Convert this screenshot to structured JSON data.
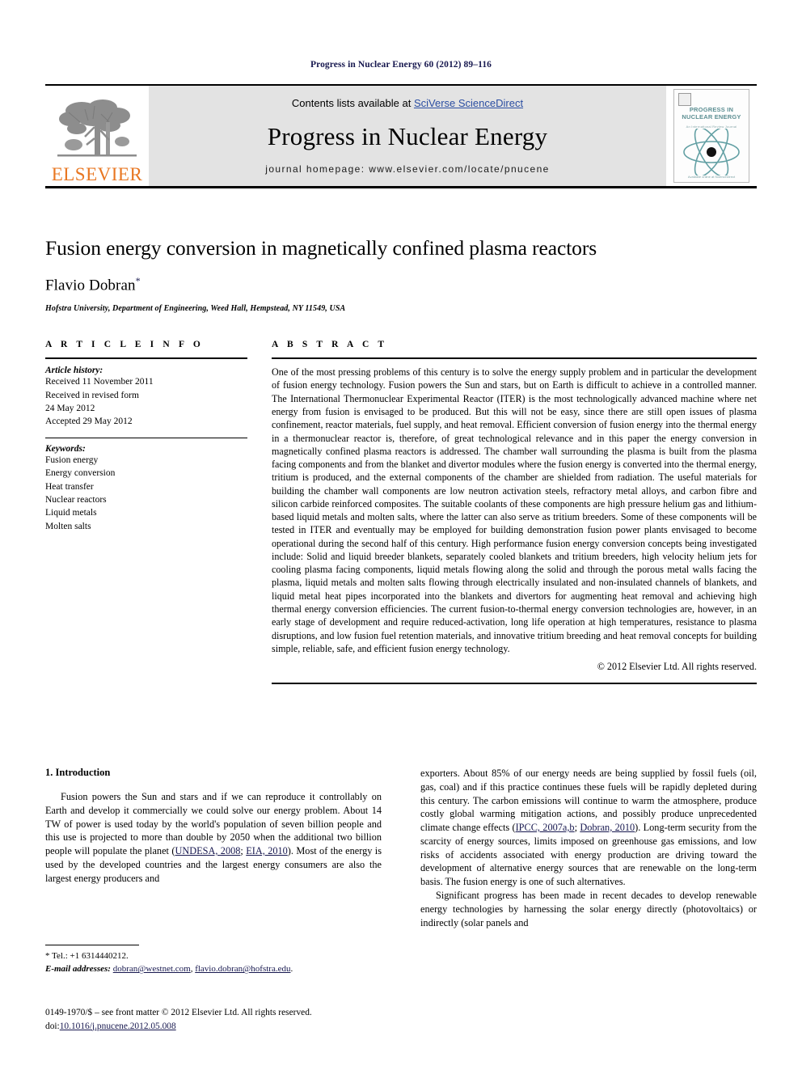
{
  "running_head": "Progress in Nuclear Energy 60 (2012) 89–116",
  "masthead": {
    "publisher_name": "ELSEVIER",
    "contents_prefix": "Contents lists available at ",
    "sciencedirect_link": "SciVerse ScienceDirect",
    "journal_title": "Progress in Nuclear Energy",
    "homepage_line": "journal homepage: www.elsevier.com/locate/pnucene",
    "cover": {
      "title": "PROGRESS IN NUCLEAR ENERGY",
      "subtitle": "An International Review Journal",
      "footer": "Available online at ScienceDirect"
    }
  },
  "article": {
    "title": "Fusion energy conversion in magnetically confined plasma reactors",
    "author": "Flavio Dobran",
    "author_marker": "*",
    "affiliation": "Hofstra University, Department of Engineering, Weed Hall, Hempstead, NY 11549, USA"
  },
  "article_info": {
    "heading": "A R T I C L E   I N F O",
    "history_label": "Article history:",
    "history_lines": [
      "Received 11 November 2011",
      "Received in revised form",
      "24 May 2012",
      "Accepted 29 May 2012"
    ],
    "keywords_label": "Keywords:",
    "keywords": [
      "Fusion energy",
      "Energy conversion",
      "Heat transfer",
      "Nuclear reactors",
      "Liquid metals",
      "Molten salts"
    ]
  },
  "abstract": {
    "heading": "A B S T R A C T",
    "text": "One of the most pressing problems of this century is to solve the energy supply problem and in particular the development of fusion energy technology. Fusion powers the Sun and stars, but on Earth is difficult to achieve in a controlled manner. The International Thermonuclear Experimental Reactor (ITER) is the most technologically advanced machine where net energy from fusion is envisaged to be produced. But this will not be easy, since there are still open issues of plasma confinement, reactor materials, fuel supply, and heat removal. Efficient conversion of fusion energy into the thermal energy in a thermonuclear reactor is, therefore, of great technological relevance and in this paper the energy conversion in magnetically confined plasma reactors is addressed. The chamber wall surrounding the plasma is built from the plasma facing components and from the blanket and divertor modules where the fusion energy is converted into the thermal energy, tritium is produced, and the external components of the chamber are shielded from radiation. The useful materials for building the chamber wall components are low neutron activation steels, refractory metal alloys, and carbon fibre and silicon carbide reinforced composites. The suitable coolants of these components are high pressure helium gas and lithium-based liquid metals and molten salts, where the latter can also serve as tritium breeders. Some of these components will be tested in ITER and eventually may be employed for building demonstration fusion power plants envisaged to become operational during the second half of this century. High performance fusion energy conversion concepts being investigated include: Solid and liquid breeder blankets, separately cooled blankets and tritium breeders, high velocity helium jets for cooling plasma facing components, liquid metals flowing along the solid and through the porous metal walls facing the plasma, liquid metals and molten salts flowing through electrically insulated and non-insulated channels of blankets, and liquid metal heat pipes incorporated into the blankets and divertors for augmenting heat removal and achieving high thermal energy conversion efficiencies. The current fusion-to-thermal energy conversion technologies are, however, in an early stage of development and require reduced-activation, long life operation at high temperatures, resistance to plasma disruptions, and low fusion fuel retention materials, and innovative tritium breeding and heat removal concepts for building simple, reliable, safe, and efficient fusion energy technology.",
    "copyright": "© 2012 Elsevier Ltd. All rights reserved."
  },
  "body": {
    "section_number_title": "1.  Introduction",
    "left_paragraph_part1": "Fusion powers the Sun and stars and if we can reproduce it controllably on Earth and develop it commercially we could solve our energy problem. About 14 TW of power is used today by the world's population of seven billion people and this use is projected to more than double by 2050 when the additional two billion people will populate the planet (",
    "left_citation_1": "UNDESA, 2008",
    "left_cite_sep": "; ",
    "left_citation_2": "EIA, 2010",
    "left_paragraph_part2": "). Most of the energy is used by the developed countries and the largest energy consumers are also the largest energy producers and",
    "right_paragraph_part1": "exporters. About 85% of our energy needs are being supplied by fossil fuels (oil, gas, coal) and if this practice continues these fuels will be rapidly depleted during this century. The carbon emissions will continue to warm the atmosphere, produce costly global warming mitigation actions, and possibly produce unprecedented climate change effects (",
    "right_citation_1": "IPCC, 2007a,b",
    "right_cite_sep": "; ",
    "right_citation_2": "Dobran, 2010",
    "right_paragraph_part2": "). Long-term security from the scarcity of energy sources, limits imposed on greenhouse gas emissions, and low risks of accidents associated with energy production are driving toward the development of alternative energy sources that are renewable on the long-term basis. The fusion energy is one of such alternatives.",
    "right_paragraph_2": "Significant progress has been made in recent decades to develop renewable energy technologies by harnessing the solar energy directly (photovoltaics) or indirectly (solar panels and"
  },
  "footnote": {
    "tel_marker": "*",
    "tel_text": " Tel.: +1 6314440212.",
    "email_label": "E-mail addresses:",
    "email_1": "dobran@westnet.com",
    "email_sep": ", ",
    "email_2": "flavio.dobran@hofstra.edu",
    "email_end": "."
  },
  "colophon": {
    "line1": "0149-1970/$ – see front matter © 2012 Elsevier Ltd. All rights reserved.",
    "doi_prefix": "doi:",
    "doi_value": "10.1016/j.pnucene.2012.05.008"
  },
  "colors": {
    "link_blue": "#2b4ea2",
    "cite_navy": "#17184f",
    "elsevier_orange": "#e87722",
    "band_gray": "#e3e3e3",
    "cover_teal": "#5d8f93"
  }
}
